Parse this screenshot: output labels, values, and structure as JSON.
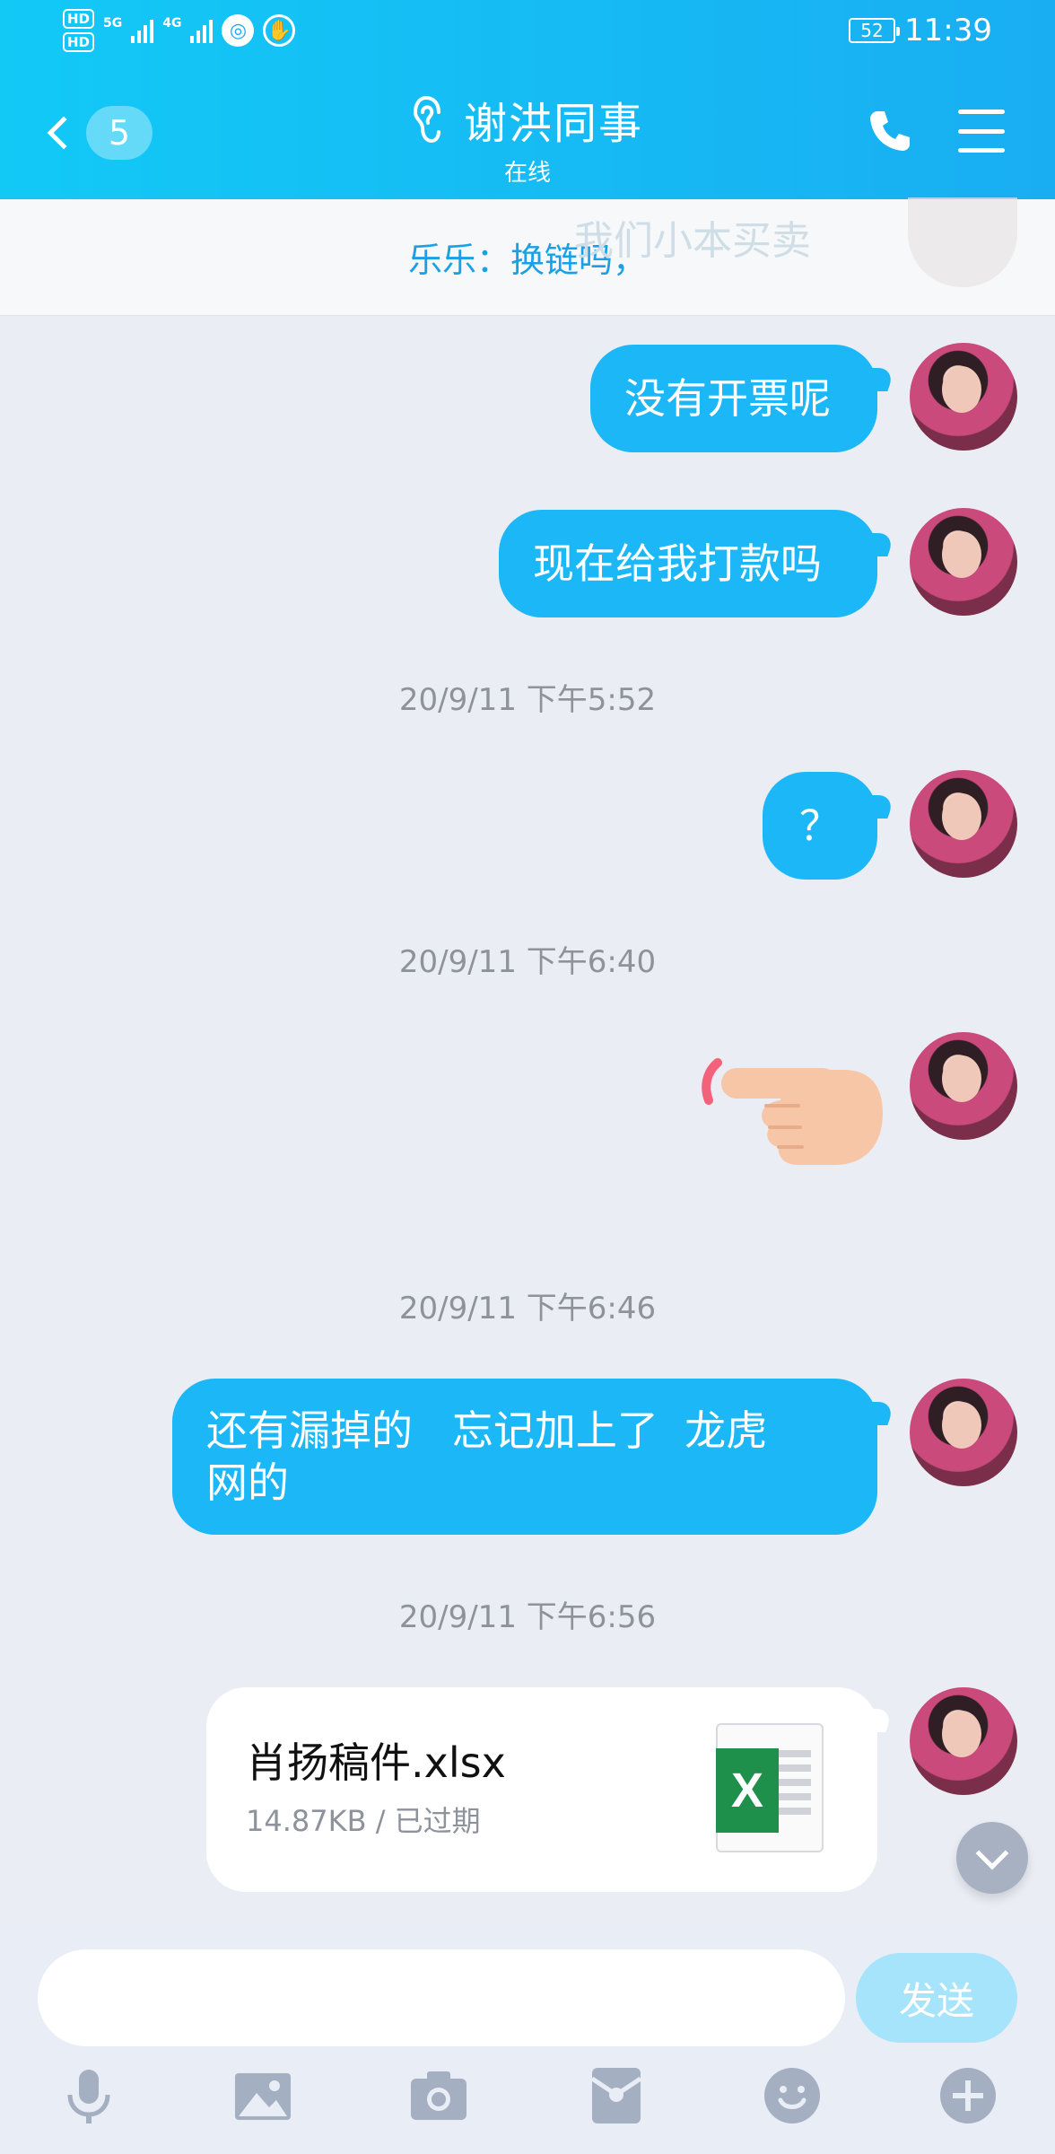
{
  "status_bar": {
    "hd1": "HD",
    "hd2": "HD",
    "net1": "5G",
    "net2": "4G",
    "battery": "52",
    "time": "11:39"
  },
  "header": {
    "back_badge": "5",
    "title": "谢洪同事",
    "subtitle": "在线"
  },
  "notice": {
    "text": "乐乐：换链吗，",
    "behind_text": "我们小本买卖"
  },
  "messages": [
    {
      "type": "text",
      "text": "没有开票呢"
    },
    {
      "type": "text",
      "text": "现在给我打款吗"
    },
    {
      "type": "timestamp",
      "text": "20/9/11 下午5:52"
    },
    {
      "type": "text",
      "text": "？"
    },
    {
      "type": "timestamp",
      "text": "20/9/11 下午6:40"
    },
    {
      "type": "sticker",
      "icon": "pointing-finger-icon"
    },
    {
      "type": "timestamp",
      "text": "20/9/11 下午6:46"
    },
    {
      "type": "text",
      "text": "还有漏掉的   忘记加上了  龙虎网的"
    },
    {
      "type": "timestamp",
      "text": "20/9/11 下午6:56"
    },
    {
      "type": "file",
      "name": "肖扬稿件.xlsx",
      "meta": "14.87KB / 已过期",
      "icon": "excel-icon"
    }
  ],
  "input": {
    "value": "",
    "placeholder": "",
    "send_label": "发送"
  },
  "toolbar": [
    "microphone-icon",
    "image-icon",
    "camera-icon",
    "red-packet-icon",
    "emoji-icon",
    "plus-icon"
  ],
  "colors": {
    "header_start": "#12c9f6",
    "header_end": "#19aef2",
    "bubble": "#1cb7f6",
    "background": "#eaedf4",
    "send_disabled": "#a5e4fa"
  }
}
